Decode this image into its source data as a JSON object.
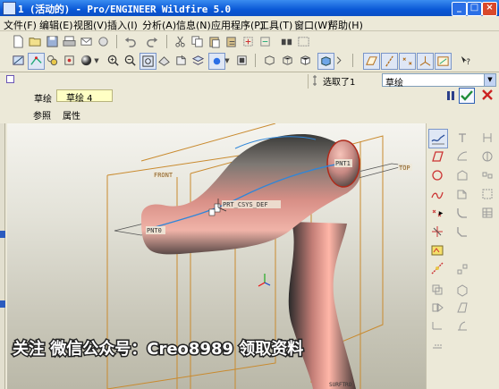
{
  "window": {
    "title": "1 (活动的) - Pro/ENGINEER Wildfire 5.0",
    "controls": [
      "_",
      "□",
      "×"
    ]
  },
  "menu": [
    "文件(F)",
    "编辑(E)",
    "视图(V)",
    "插入(I)",
    "分析(A)",
    "信息(N)",
    "应用程序(P)",
    "工具(T)",
    "窗口(W)",
    "帮助(H)"
  ],
  "selection": {
    "filter_label": "选取了1",
    "filter_value": "草绘"
  },
  "dashboard": {
    "sketch_label": "草绘",
    "sketch_value": "草绘 4",
    "tabs": [
      "参照",
      "属性"
    ]
  },
  "model": {
    "datum_labels": [
      "FRONT",
      "TOP",
      "PNT1",
      "PNT0",
      "PRT_CSYS_DEF",
      "SURFTRO"
    ]
  },
  "watermark": "关注 微信公众号：Creo8989 领取资料",
  "colors": {
    "title_bar": "#0a58d6",
    "datum_plane": "#c98a2e",
    "surface": "#d98a83",
    "accent": "#2b6fe6"
  }
}
